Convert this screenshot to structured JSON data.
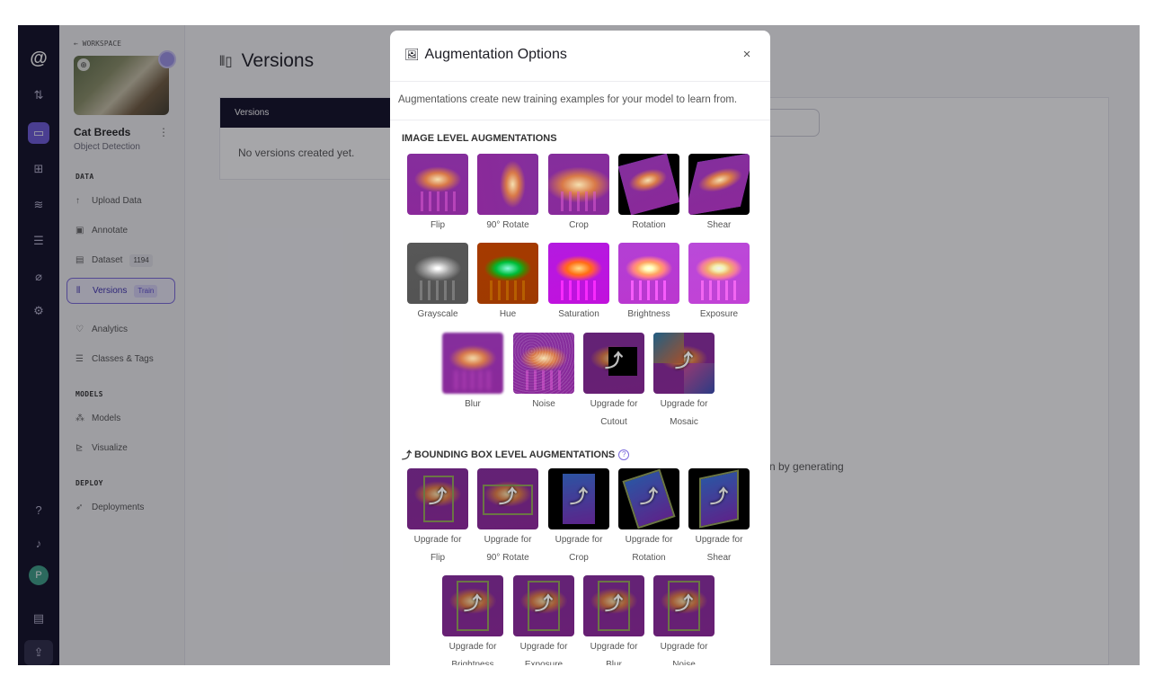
{
  "rail": {
    "icons": [
      "logo-icon",
      "swap-icon",
      "project-icon",
      "workflows-icon",
      "analytics-icon",
      "storage-icon",
      "tags-icon",
      "settings-icon",
      "help-icon",
      "bell-icon",
      "avatar",
      "docs-icon",
      "upload-icon"
    ],
    "avatar_letter": "P",
    "logo_glyph": "@"
  },
  "sidebar": {
    "back_label": "← WORKSPACE",
    "project_name": "Cat Breeds",
    "project_type": "Object Detection",
    "sections": {
      "data": "DATA",
      "models": "MODELS",
      "deploy": "DEPLOY"
    },
    "items": [
      {
        "label": "Upload Data",
        "glyph": "↑"
      },
      {
        "label": "Annotate",
        "glyph": "▣"
      },
      {
        "label": "Dataset",
        "glyph": "▤",
        "badge": "1194"
      },
      {
        "label": "Versions",
        "glyph": "⫴",
        "badge": "Train"
      },
      {
        "label": "Analytics",
        "glyph": "♡"
      },
      {
        "label": "Classes & Tags",
        "glyph": "☰"
      },
      {
        "label": "Models",
        "glyph": "⁂"
      },
      {
        "label": "Visualize",
        "glyph": "⊵"
      },
      {
        "label": "Deployments",
        "glyph": "➶"
      }
    ]
  },
  "main": {
    "title": "Versions",
    "versions_header": "Versions",
    "empty_text": "No versions created yet.",
    "right_text_fragment": "n by generating"
  },
  "modal": {
    "title": "Augmentation Options",
    "close": "×",
    "description": "Augmentations create new training examples for your model to learn from.",
    "image_heading": "IMAGE LEVEL AUGMENTATIONS",
    "bbox_heading": "BOUNDING BOX LEVEL AUGMENTATIONS",
    "upgrade_glyph": "⤴",
    "help_glyph": "?",
    "image_level": [
      {
        "line1": "Flip",
        "line2": ""
      },
      {
        "line1": "90° Rotate",
        "line2": ""
      },
      {
        "line1": "Crop",
        "line2": ""
      },
      {
        "line1": "Rotation",
        "line2": ""
      },
      {
        "line1": "Shear",
        "line2": ""
      },
      {
        "line1": "Grayscale",
        "line2": ""
      },
      {
        "line1": "Hue",
        "line2": ""
      },
      {
        "line1": "Saturation",
        "line2": ""
      },
      {
        "line1": "Brightness",
        "line2": ""
      },
      {
        "line1": "Exposure",
        "line2": ""
      },
      {
        "line1": "Blur",
        "line2": ""
      },
      {
        "line1": "Noise",
        "line2": ""
      },
      {
        "line1": "Upgrade for",
        "line2": "Cutout"
      },
      {
        "line1": "Upgrade for",
        "line2": "Mosaic"
      }
    ],
    "bbox_level": [
      {
        "line1": "Upgrade for",
        "line2": "Flip"
      },
      {
        "line1": "Upgrade for",
        "line2": "90° Rotate"
      },
      {
        "line1": "Upgrade for",
        "line2": "Crop"
      },
      {
        "line1": "Upgrade for",
        "line2": "Rotation"
      },
      {
        "line1": "Upgrade for",
        "line2": "Shear"
      },
      {
        "line1": "Upgrade for",
        "line2": "Brightness"
      },
      {
        "line1": "Upgrade for",
        "line2": "Exposure"
      },
      {
        "line1": "Upgrade for",
        "line2": "Blur"
      },
      {
        "line1": "Upgrade for",
        "line2": "Noise"
      }
    ]
  }
}
